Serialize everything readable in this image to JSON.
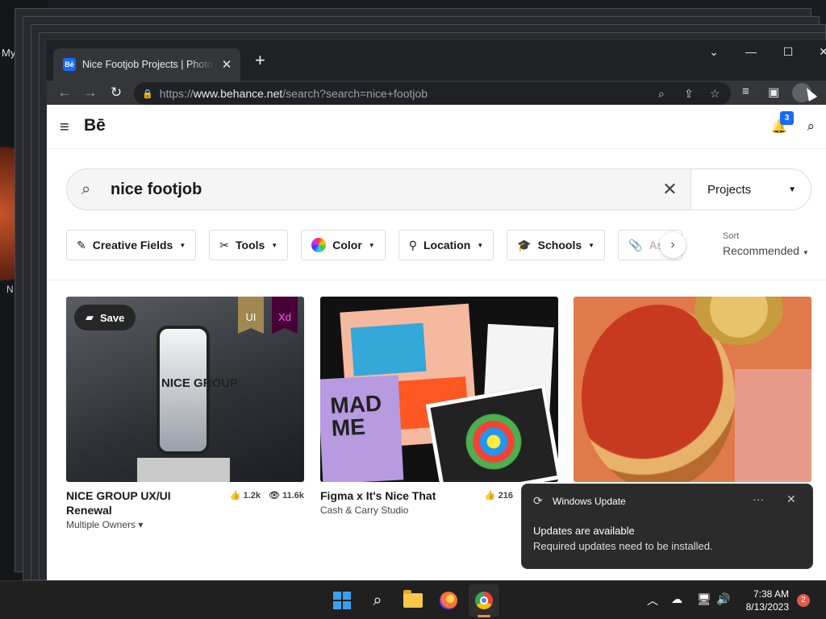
{
  "desktop": {
    "label_my": "My",
    "label_n": "N"
  },
  "browser": {
    "tab_title": "Nice Footjob Projects | Photos, videos, logos",
    "favicon": "Bē",
    "new_tab": "+",
    "url_prefix": "https://",
    "url_domain": "www.behance.net",
    "url_path": "/search?search=nice+footjob"
  },
  "header": {
    "logo": "Bē",
    "notifications": "3"
  },
  "search": {
    "query": "nice footjob",
    "type": "Projects"
  },
  "filters": [
    {
      "label": "Creative Fields",
      "icon": "creative-fields-icon"
    },
    {
      "label": "Tools",
      "icon": "tools-icon"
    },
    {
      "label": "Color",
      "icon": "color-wheel-icon"
    },
    {
      "label": "Location",
      "icon": "location-pin-icon"
    },
    {
      "label": "Schools",
      "icon": "graduation-cap-icon"
    },
    {
      "label": "Asse",
      "icon": "paperclip-icon"
    }
  ],
  "sort": {
    "label": "Sort",
    "value": "Recommended"
  },
  "cards": [
    {
      "title": "NICE GROUP UX/UI Renewal",
      "owner": "Multiple Owners",
      "likes": "1.2k",
      "views": "11.6k",
      "save": "Save",
      "badges": [
        "UI",
        "Xd"
      ],
      "thumb_text": "NICE GROUP"
    },
    {
      "title": "Figma x It's Nice That",
      "owner": "Cash & Carry Studio",
      "likes": "216",
      "thumb_text": "MAD ME"
    },
    {
      "title": "",
      "owner": ""
    }
  ],
  "toast": {
    "app": "Windows Update",
    "title": "Updates are available",
    "body": "Required updates need to be installed.",
    "more": "···"
  },
  "taskbar": {
    "time": "7:38 AM",
    "date": "8/13/2023",
    "notifications": "2"
  }
}
